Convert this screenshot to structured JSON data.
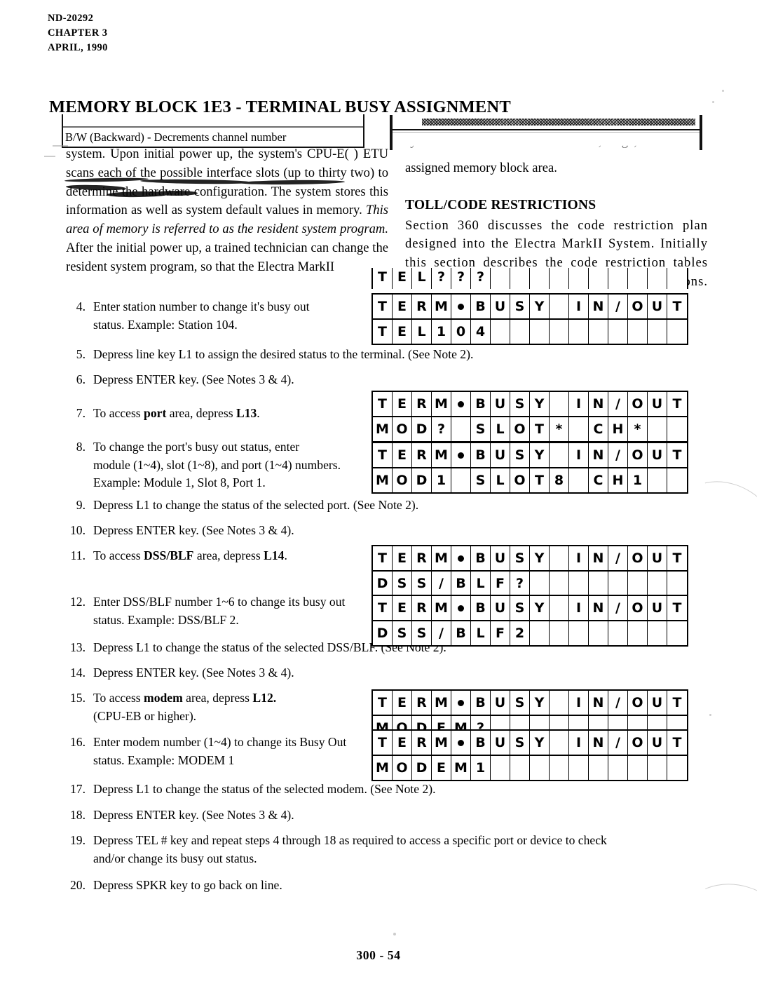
{
  "header": {
    "doc_number": "ND-20292",
    "chapter": "CHAPTER 3",
    "date": "APRIL, 1990"
  },
  "section_title": "MEMORY BLOCK 1E3 - TERMINAL BUSY ASSIGNMENT",
  "scan_artifacts": {
    "ghost_row_faded": "ENTER -  Enters each port assignment",
    "ghost_row_visible": "B/W (Backward) -  Decrements channel number"
  },
  "intro": {
    "left_column": "system. Upon initial power up, the system's CPU-E( ) ETU scans each of the possible interface slots (up to thirty two) to determine the hardware configuration. The system stores this information as well as system default values in memory.",
    "left_italic": "This area of memory is referred to as the resident system program.",
    "left_column_2": "After the initial power up, a trained technician can change the resident system program, so that the Electra MarkII",
    "right_faded_line": "system as well as their default values, range, and the",
    "right_column": "assigned memory block area.",
    "toll_heading": "TOLL/CODE RESTRICTIONS",
    "toll_body": "Section 360 discusses the code restriction plan designed into the Electra MarkII System. Initially this section describes the code restriction tables and their general use when dial restricting stations. Discussion"
  },
  "steps": [
    {
      "num": "4.",
      "lines": [
        "Enter station number to change it's busy out",
        "status. Example:   Station 104."
      ]
    },
    {
      "num": "5.",
      "lines": [
        "Depress line key L1 to assign the desired status to the terminal. (See Note 2)."
      ]
    },
    {
      "num": "6.",
      "lines": [
        "Depress ENTER key.  (See Notes 3 & 4)."
      ]
    },
    {
      "num": "7.",
      "lines": [
        "To access port area, depress L13."
      ]
    },
    {
      "num": "8.",
      "lines": [
        "To  change  the  port's  busy  out  status,  enter",
        "module (1~4), slot (1~8), and port (1~4) numbers.",
        "Example:   Module 1, Slot 8, Port 1."
      ]
    },
    {
      "num": "9.",
      "lines": [
        "Depress L1 to change the status of the selected port.  (See Note 2)."
      ]
    },
    {
      "num": "10.",
      "lines": [
        "Depress ENTER key.  (See Notes 3 & 4)."
      ]
    },
    {
      "num": "11.",
      "lines": [
        "To access DSS/BLF area, depress L14."
      ]
    },
    {
      "num": "12.",
      "lines": [
        "Enter DSS/BLF number 1~6 to change its busy out",
        "status.  Example:  DSS/BLF 2."
      ]
    },
    {
      "num": "13.",
      "lines": [
        "Depress L1 to change the status of the selected DSS/BLF. (See Note 2)."
      ]
    },
    {
      "num": "14.",
      "lines": [
        "Depress ENTER key.  (See Notes 3 & 4)."
      ]
    },
    {
      "num": "15.",
      "lines": [
        "To access modem area, depress L12.",
        "(CPU-EB or higher)."
      ]
    },
    {
      "num": "16.",
      "lines": [
        "Enter modem number (1~4) to change its Busy Out",
        "status.  Example: MODEM 1"
      ]
    },
    {
      "num": "17.",
      "lines": [
        "Depress L1 to change the status of the selected modem. (See Note 2)."
      ]
    },
    {
      "num": "18.",
      "lines": [
        "Depress ENTER key.  (See Notes 3 & 4)."
      ]
    },
    {
      "num": "19.",
      "lines": [
        "Depress TEL # key and repeat steps 4 through 18 as required to access a specific port or device to check",
        "and/or change its busy out status."
      ]
    },
    {
      "num": "20.",
      "lines": [
        "Depress SPKR key to go back on line."
      ]
    }
  ],
  "displays": [
    {
      "id": "display-tel-prompt-partial",
      "rows": [
        [
          "T",
          "E",
          "L",
          "?",
          "?",
          "?",
          "",
          "",
          "",
          "",
          "",
          "",
          "",
          "",
          "",
          ""
        ]
      ]
    },
    {
      "id": "display-station",
      "rows": [
        [
          "T",
          "E",
          "R",
          "M",
          "•",
          "B",
          "U",
          "S",
          "Y",
          "",
          "I",
          "N",
          "/",
          "O",
          "U",
          "T"
        ],
        [
          "T",
          "E",
          "L",
          "1",
          "0",
          "4",
          "",
          "",
          "",
          "",
          "",
          "",
          "",
          "",
          "",
          ""
        ]
      ]
    },
    {
      "id": "display-port-prompt",
      "rows": [
        [
          "T",
          "E",
          "R",
          "M",
          "•",
          "B",
          "U",
          "S",
          "Y",
          "",
          "I",
          "N",
          "/",
          "O",
          "U",
          "T"
        ],
        [
          "M",
          "O",
          "D",
          "?",
          "",
          "S",
          "L",
          "O",
          "T",
          "*",
          "",
          "C",
          "H",
          "*",
          "",
          ""
        ]
      ]
    },
    {
      "id": "display-port-entered",
      "rows": [
        [
          "T",
          "E",
          "R",
          "M",
          "•",
          "B",
          "U",
          "S",
          "Y",
          "",
          "I",
          "N",
          "/",
          "O",
          "U",
          "T"
        ],
        [
          "M",
          "O",
          "D",
          "1",
          "",
          "S",
          "L",
          "O",
          "T",
          "8",
          "",
          "C",
          "H",
          "1",
          "",
          ""
        ]
      ]
    },
    {
      "id": "display-dssblf-prompt",
      "rows": [
        [
          "T",
          "E",
          "R",
          "M",
          "•",
          "B",
          "U",
          "S",
          "Y",
          "",
          "I",
          "N",
          "/",
          "O",
          "U",
          "T"
        ],
        [
          "D",
          "S",
          "S",
          "/",
          "B",
          "L",
          "F",
          "?",
          "",
          "",
          "",
          "",
          "",
          "",
          "",
          ""
        ]
      ]
    },
    {
      "id": "display-dssblf-entered",
      "rows": [
        [
          "T",
          "E",
          "R",
          "M",
          "•",
          "B",
          "U",
          "S",
          "Y",
          "",
          "I",
          "N",
          "/",
          "O",
          "U",
          "T"
        ],
        [
          "D",
          "S",
          "S",
          "/",
          "B",
          "L",
          "F",
          "2",
          "",
          "",
          "",
          "",
          "",
          "",
          "",
          ""
        ]
      ]
    },
    {
      "id": "display-modem-prompt",
      "rows": [
        [
          "T",
          "E",
          "R",
          "M",
          "•",
          "B",
          "U",
          "S",
          "Y",
          "",
          "I",
          "N",
          "/",
          "O",
          "U",
          "T"
        ],
        [
          "M",
          "O",
          "D",
          "E",
          "M",
          "?",
          "",
          "",
          "",
          "",
          "",
          "",
          "",
          "",
          "",
          ""
        ]
      ]
    },
    {
      "id": "display-modem-entered",
      "rows": [
        [
          "T",
          "E",
          "R",
          "M",
          "•",
          "B",
          "U",
          "S",
          "Y",
          "",
          "I",
          "N",
          "/",
          "O",
          "U",
          "T"
        ],
        [
          "M",
          "O",
          "D",
          "E",
          "M",
          "1",
          "",
          "",
          "",
          "",
          "",
          "",
          "",
          "",
          "",
          ""
        ]
      ]
    }
  ],
  "footer": {
    "page_number": "300 - 54"
  }
}
